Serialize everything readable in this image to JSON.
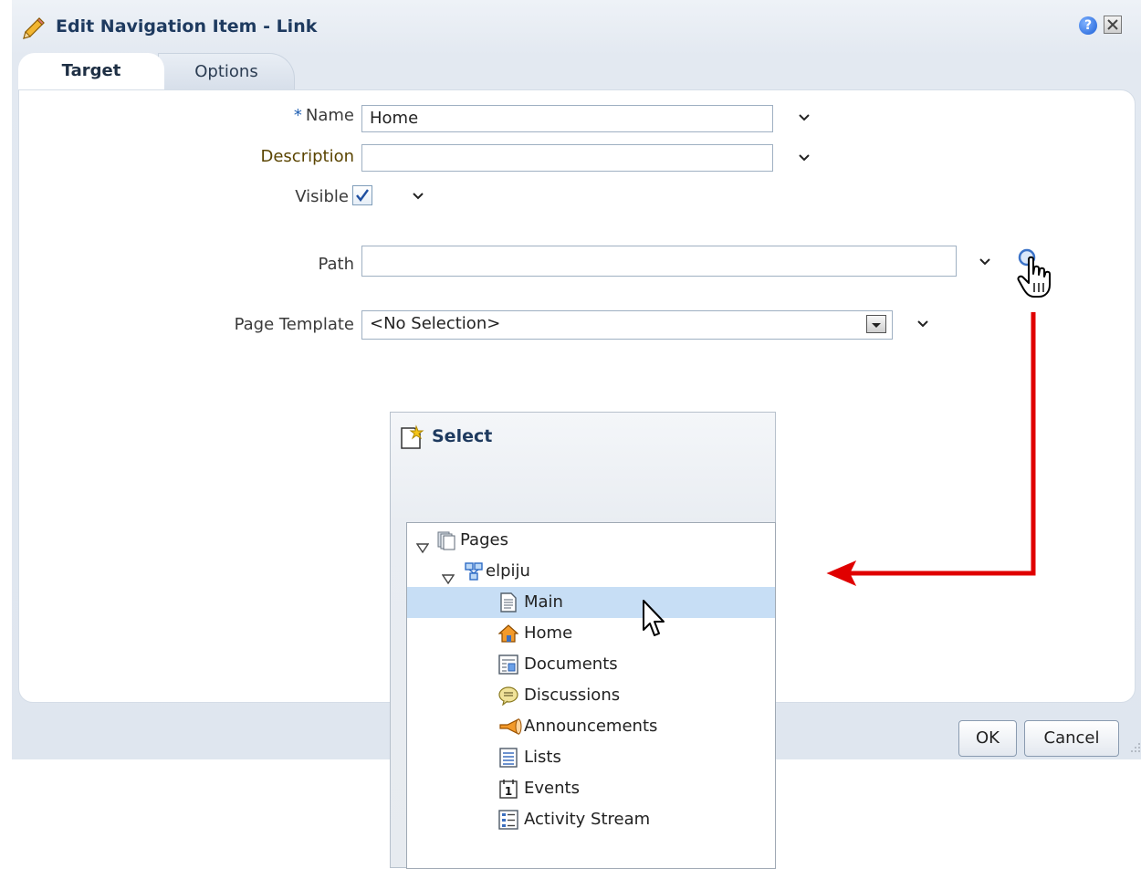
{
  "dialog": {
    "title": "Edit Navigation Item - Link",
    "help_icon": "help-icon",
    "close_icon": "close-icon"
  },
  "tabs": [
    {
      "label": "Target",
      "active": true
    },
    {
      "label": "Options",
      "active": false
    }
  ],
  "form": {
    "name_required_marker": "*",
    "name_label": "Name",
    "name_value": "Home",
    "description_label": "Description",
    "description_value": "",
    "visible_label": "Visible",
    "visible_checked": true,
    "path_label": "Path",
    "path_value": "",
    "page_template_label": "Page Template",
    "page_template_value": "<No Selection>"
  },
  "footer": {
    "ok_label": "OK",
    "cancel_label": "Cancel"
  },
  "select_popup": {
    "title": "Select",
    "tree": [
      {
        "label": "Pages",
        "icon": "pages-icon",
        "expanded": true,
        "level": 0
      },
      {
        "label": "elpiju",
        "icon": "space-icon",
        "expanded": true,
        "level": 1
      },
      {
        "label": "Main",
        "icon": "page-icon",
        "selected": true,
        "level": 2
      },
      {
        "label": "Home",
        "icon": "home-icon",
        "level": 2
      },
      {
        "label": "Documents",
        "icon": "documents-icon",
        "level": 2
      },
      {
        "label": "Discussions",
        "icon": "discussions-icon",
        "level": 2
      },
      {
        "label": "Announcements",
        "icon": "announcements-icon",
        "level": 2
      },
      {
        "label": "Lists",
        "icon": "lists-icon",
        "level": 2
      },
      {
        "label": "Events",
        "icon": "events-icon",
        "level": 2
      },
      {
        "label": "Activity Stream",
        "icon": "activity-stream-icon",
        "level": 2
      }
    ]
  },
  "colors": {
    "title_text": "#1e3a5f",
    "label_text": "#5a4400",
    "selected_row": "#c7def5",
    "annotation_arrow": "#e00000"
  }
}
